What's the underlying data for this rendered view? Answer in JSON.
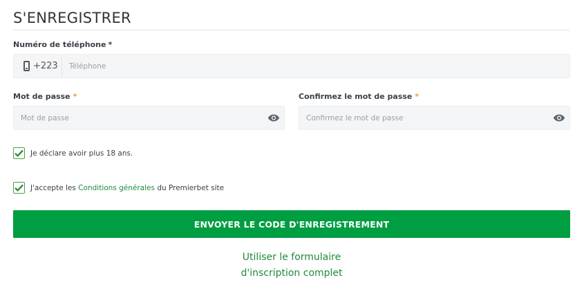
{
  "header": {
    "title": "S'ENREGISTRER"
  },
  "phone": {
    "label": "Numéro de téléphone",
    "required_mark": "*",
    "prefix": "+223",
    "placeholder": "Téléphone",
    "value": ""
  },
  "password": {
    "label": "Mot de passe",
    "required_mark": "*",
    "placeholder": "Mot de passe",
    "value": ""
  },
  "confirm_password": {
    "label": "Confirmez le mot de passe",
    "required_mark": "*",
    "placeholder": "Confirmez le mot de passe",
    "value": ""
  },
  "checkboxes": {
    "age": {
      "text": "Je déclare avoir plus 18 ans.",
      "checked": true
    },
    "terms": {
      "text_before": "J'accepte les",
      "link_text": "Conditions générales",
      "text_after": "du Premierbet site",
      "checked": true
    }
  },
  "submit": {
    "label": "ENVOYER LE CODE D'ENREGISTREMENT"
  },
  "full_form_link": {
    "line1": "Utiliser le formulaire",
    "line2": "d'inscription complet"
  },
  "colors": {
    "primary_green": "#009e43",
    "link_green": "#1e8b3c",
    "required_orange": "#e3a03a",
    "input_bg": "#f4f5f6"
  }
}
